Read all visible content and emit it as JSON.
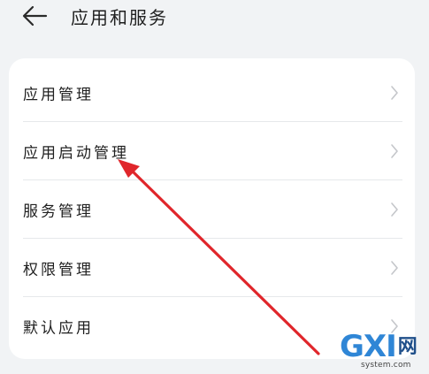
{
  "header": {
    "title": "应用和服务",
    "back_icon": "arrow-left-icon"
  },
  "settings_list": {
    "items": [
      {
        "label": "应用管理",
        "icon": "chevron-right-icon"
      },
      {
        "label": "应用启动管理",
        "icon": "chevron-right-icon"
      },
      {
        "label": "服务管理",
        "icon": "chevron-right-icon"
      },
      {
        "label": "权限管理",
        "icon": "chevron-right-icon"
      },
      {
        "label": "默认应用",
        "icon": "chevron-right-icon"
      }
    ]
  },
  "annotation": {
    "type": "red-arrow",
    "color": "#e0262b",
    "points_to": "应用启动管理"
  },
  "watermark": {
    "logo_text": "GXI",
    "logo_cn": "网",
    "url": "system.com"
  },
  "colors": {
    "background": "#f1f3f5",
    "card": "#ffffff",
    "chevron": "#c4c6ca",
    "annotation_red": "#e0262b",
    "watermark_blue": "#2f86d6"
  }
}
